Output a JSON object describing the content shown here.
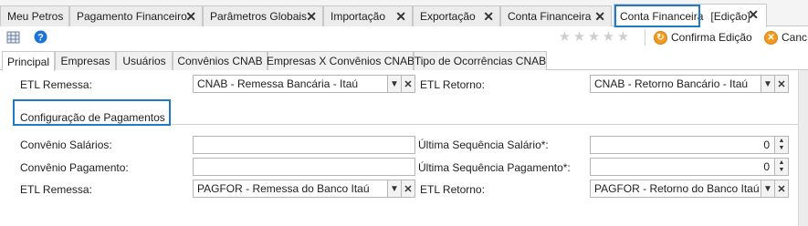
{
  "doc_tabs": [
    {
      "label": "Meu Petros",
      "closable": false
    },
    {
      "label": "Pagamento Financeiro",
      "closable": true
    },
    {
      "label": "Parâmetros Globais",
      "closable": true
    },
    {
      "label": "Importação",
      "closable": true
    },
    {
      "label": "Exportação",
      "closable": true
    },
    {
      "label": "Conta Financeira",
      "closable": true
    },
    {
      "label": "Conta Financeira",
      "label_suffix": "[Edição]",
      "closable": true,
      "active": true
    }
  ],
  "close_glyph": "✕",
  "toolbar": {
    "grid_icon": "grid-icon",
    "help_icon": "help-icon",
    "star_icon": "★",
    "confirm_label": "Confirma Edição",
    "cancel_label": "Canc",
    "confirm_icon": "confirm-circle-icon",
    "cancel_icon": "cancel-circle-icon",
    "accent_color": "#f19a1e"
  },
  "sub_tabs": [
    {
      "label": "Principal",
      "active": true
    },
    {
      "label": "Empresas"
    },
    {
      "label": "Usuários"
    },
    {
      "label": "Convênios CNAB"
    },
    {
      "label": "Empresas X Convênios CNAB"
    },
    {
      "label": "Tipo de Ocorrências CNAB"
    }
  ],
  "cnab_section": {
    "etl_remessa_label": "ETL Remessa:",
    "etl_remessa_value": "CNAB - Remessa Bancária - Itaú",
    "etl_retorno_label": "ETL Retorno:",
    "etl_retorno_value": "CNAB - Retorno Bancário - Itaú"
  },
  "pagamentos_section": {
    "title": "Configuração de Pagamentos",
    "convenio_salarios_label": "Convênio Salários:",
    "convenio_salarios_value": "",
    "convenio_pagamento_label": "Convênio Pagamento:",
    "convenio_pagamento_value": "",
    "ultima_seq_salario_label": "Última Sequência Salário*:",
    "ultima_seq_salario_value": "0",
    "ultima_seq_pagamento_label": "Última Sequência Pagamento*:",
    "ultima_seq_pagamento_value": "0",
    "etl_remessa_label": "ETL Remessa:",
    "etl_remessa_value": "PAGFOR - Remessa do Banco Itaú",
    "etl_retorno_label": "ETL Retorno:",
    "etl_retorno_value": "PAGFOR - Retorno do Banco Itaú"
  },
  "highlight_color": "#1f7cc4"
}
